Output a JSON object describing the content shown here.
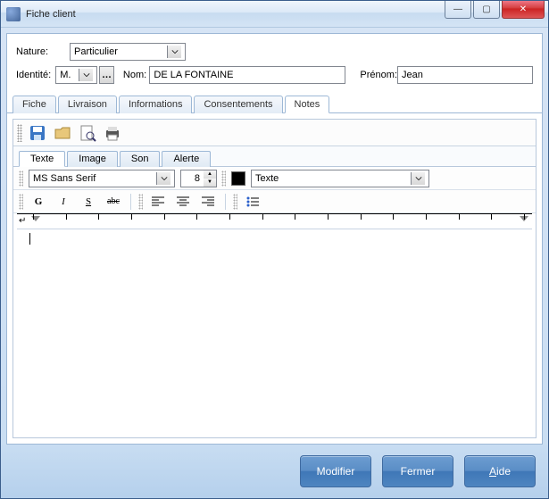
{
  "window": {
    "title": "Fiche client"
  },
  "win_buttons": {
    "minimize": "—",
    "maximize": "▢",
    "close": "✕"
  },
  "form": {
    "nature_label": "Nature:",
    "nature_value": "Particulier",
    "identite_label": "Identité:",
    "identite_title": "M.",
    "nom_label": "Nom:",
    "nom_value": "DE LA FONTAINE",
    "prenom_label": "Prénom:",
    "prenom_value": "Jean"
  },
  "tabs": {
    "fiche": "Fiche",
    "livraison": "Livraison",
    "informations": "Informations",
    "consentements": "Consentements",
    "notes": "Notes"
  },
  "subtabs": {
    "texte": "Texte",
    "image": "Image",
    "son": "Son",
    "alerte": "Alerte"
  },
  "toolbar_icons": {
    "save": "save-icon",
    "open": "open-icon",
    "preview": "preview-icon",
    "print": "print-icon"
  },
  "richtext": {
    "font": "MS Sans Serif",
    "size": "8",
    "style_label": "Texte"
  },
  "fmt": {
    "bold": "G",
    "italic": "I",
    "underline": "S",
    "strike": "abc"
  },
  "footer": {
    "modifier": "Modifier",
    "fermer": "Fermer",
    "aide_letter": "A",
    "aide_rest": "ide"
  },
  "colors": {
    "accent_blue": "#4e85c0",
    "window_border": "#3b5e8c"
  }
}
